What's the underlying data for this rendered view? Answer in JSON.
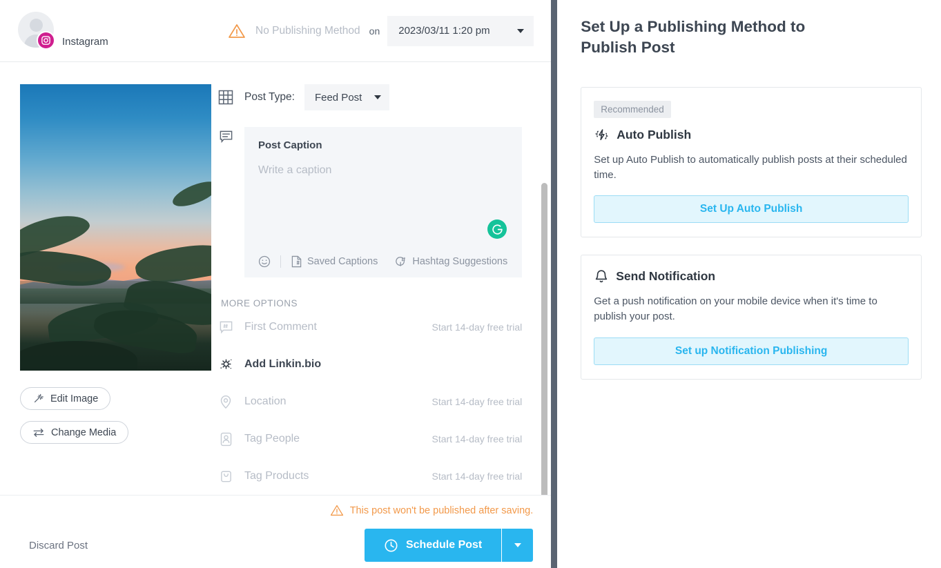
{
  "header": {
    "account_name": "Instagram",
    "avatar_icon": "user-placeholder-avatar",
    "platform_badge_icon": "instagram-icon",
    "warning_icon": "warning-triangle-icon",
    "publishing_status": "No Publishing Method",
    "on_label": "on",
    "schedule_datetime": "2023/03/11 1:20 pm",
    "dropdown_icon": "chevron-down-icon"
  },
  "media": {
    "preview_alt": "sunset-lake-palm-trees-photo",
    "edit_image_label": "Edit Image",
    "edit_image_icon": "magic-wand-icon",
    "change_media_label": "Change Media",
    "change_media_icon": "swap-arrows-icon"
  },
  "post_type": {
    "icon": "grid-icon",
    "label": "Post Type:",
    "value": "Feed Post",
    "dropdown_icon": "chevron-down-icon"
  },
  "caption": {
    "icon": "comment-lines-icon",
    "title": "Post Caption",
    "placeholder": "Write a caption",
    "value": "",
    "grammarly_icon": "grammarly-g-icon",
    "tools": [
      {
        "icon": "emoji-smiley-icon",
        "label": ""
      },
      {
        "icon": "saved-captions-icon",
        "label": "Saved Captions"
      },
      {
        "icon": "hashtag-suggestions-icon",
        "label": "Hashtag Suggestions"
      }
    ]
  },
  "more_options": {
    "section_label": "MORE OPTIONS",
    "items": [
      {
        "icon": "first-comment-icon",
        "label": "First Comment",
        "trial": "Start 14-day free trial",
        "active": false
      },
      {
        "icon": "linkinbio-sparkle-icon",
        "label": "Add Linkin.bio",
        "trial": "",
        "active": true
      },
      {
        "icon": "location-pin-icon",
        "label": "Location",
        "trial": "Start 14-day free trial",
        "active": false
      },
      {
        "icon": "tag-people-icon",
        "label": "Tag People",
        "trial": "Start 14-day free trial",
        "active": false
      },
      {
        "icon": "tag-products-bag-icon",
        "label": "Tag Products",
        "trial": "Start 14-day free trial",
        "active": false
      }
    ]
  },
  "footer": {
    "warning_icon": "warning-triangle-icon",
    "warning_text": "This post won't be published after saving.",
    "discard_label": "Discard Post",
    "schedule_label": "Schedule Post",
    "schedule_icon": "clock-icon",
    "schedule_dropdown_icon": "chevron-down-icon"
  },
  "side_panel": {
    "title": "Set Up a Publishing Method to Publish Post",
    "cards": [
      {
        "badge": "Recommended",
        "icon": "auto-publish-bolt-icon",
        "title": "Auto Publish",
        "description": "Set up Auto Publish to automatically publish posts at their scheduled time.",
        "cta": "Set Up Auto Publish"
      },
      {
        "badge": "",
        "icon": "bell-icon",
        "title": "Send Notification",
        "description": "Get a push notification on your mobile device when it's time to publish your post.",
        "cta": "Set up Notification Publishing"
      }
    ]
  },
  "colors": {
    "accent_blue": "#29b6ef",
    "warning_orange": "#f2994a",
    "instagram_pink": "#cf1f8f",
    "grammarly_green": "#15c39a",
    "muted_text": "#b6bcc6",
    "divider_slate": "#5a6472"
  }
}
